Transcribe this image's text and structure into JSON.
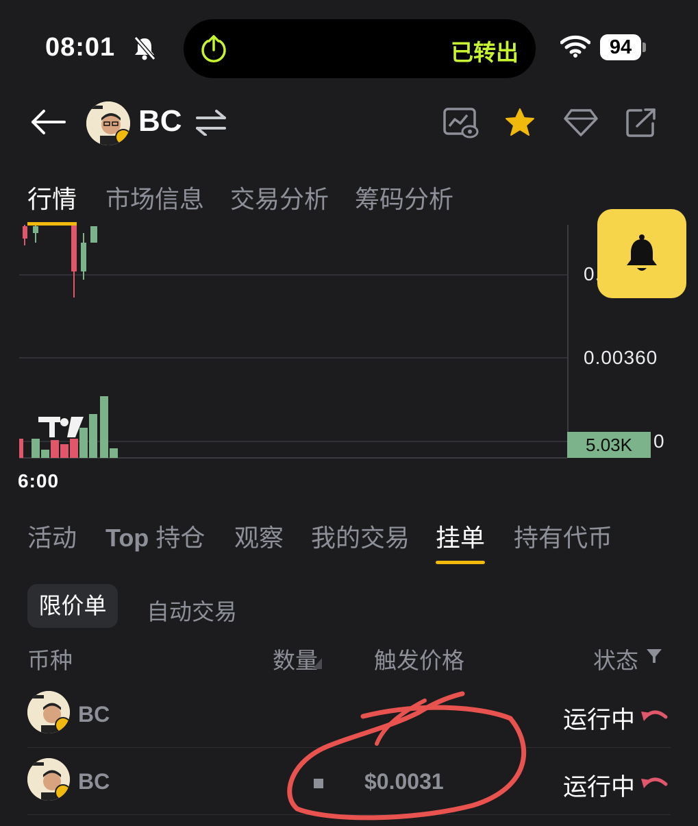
{
  "status_bar": {
    "time": "08:01",
    "island_text": "已转出",
    "battery": "94"
  },
  "header": {
    "token_symbol": "BC"
  },
  "main_tabs": [
    "行情",
    "市场信息",
    "交易分析",
    "筹码分析"
  ],
  "chart": {
    "price_label_partial": "0.",
    "price_label": "0.00360",
    "zero_label": "0",
    "volume_badge": "5.03K",
    "time_label": "6:00"
  },
  "detail_tabs": [
    {
      "bold": "Top",
      "rest": " 持仓"
    },
    {
      "bold": "",
      "rest": "活动"
    },
    {
      "bold": "",
      "rest": "观察"
    },
    {
      "bold": "",
      "rest": "我的交易"
    },
    {
      "bold": "",
      "rest": "挂单"
    },
    {
      "bold": "",
      "rest": "持有代币"
    }
  ],
  "order_tabs": {
    "limit": "限价单",
    "auto": "自动交易"
  },
  "columns": {
    "symbol": "币种",
    "quantity": "数量",
    "trigger_price": "触发价格",
    "status": "状态"
  },
  "orders": [
    {
      "symbol": "BC",
      "quantity": "",
      "trigger_price": "",
      "status": "运行中"
    },
    {
      "symbol": "BC",
      "quantity": "",
      "trigger_price": "$0.0031",
      "status": "运行中"
    }
  ],
  "colors": {
    "accent": "#f0b90b",
    "up": "#7db38b",
    "down": "#e0566b",
    "annotation": "#e8534f"
  }
}
